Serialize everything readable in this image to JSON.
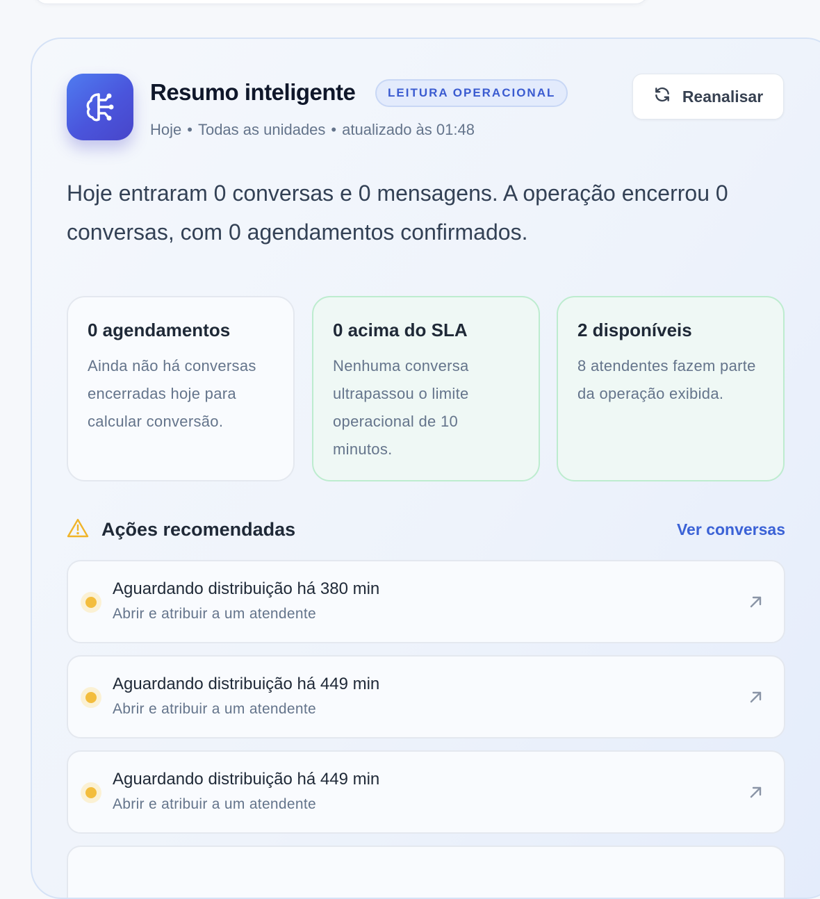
{
  "card": {
    "title": "Resumo inteligente",
    "badge": "LEITURA OPERACIONAL",
    "meta": {
      "period": "Hoje",
      "scope": "Todas as unidades",
      "updated": "atualizado às 01:48"
    },
    "reanalyze_label": "Reanalisar",
    "summary": "Hoje entraram 0 conversas e 0 mensagens. A operação encerrou 0 conversas, com 0 agendamentos confirmados."
  },
  "stats": [
    {
      "title": "0 agendamentos",
      "text": "Ainda não há conversas encerradas hoje para calcular conversão.",
      "tone": "neutral"
    },
    {
      "title": "0 acima do SLA",
      "text": "Nenhuma conversa ultrapassou o limite operacional de 10 minutos.",
      "tone": "green"
    },
    {
      "title": "2 disponíveis",
      "text": "8 atendentes fazem parte da operação exibida.",
      "tone": "green"
    }
  ],
  "actions": {
    "heading": "Ações recomendadas",
    "link": "Ver conversas",
    "items": [
      {
        "title": "Aguardando distribuição há 380 min",
        "subtitle": "Abrir e atribuir a um atendente"
      },
      {
        "title": "Aguardando distribuição há 449 min",
        "subtitle": "Abrir e atribuir a um atendente"
      },
      {
        "title": "Aguardando distribuição há 449 min",
        "subtitle": "Abrir e atribuir a um atendente"
      }
    ]
  },
  "icons": {
    "app": "brain-icon",
    "reanalyze": "refresh-icon",
    "heading": "warning-icon",
    "row_action": "arrow-up-right-icon",
    "row_status": "status-dot"
  },
  "colors": {
    "accent": "#4a55dc",
    "link": "#3b62d6",
    "warning": "#f3bd3d",
    "success_border": "#bdeccf"
  }
}
